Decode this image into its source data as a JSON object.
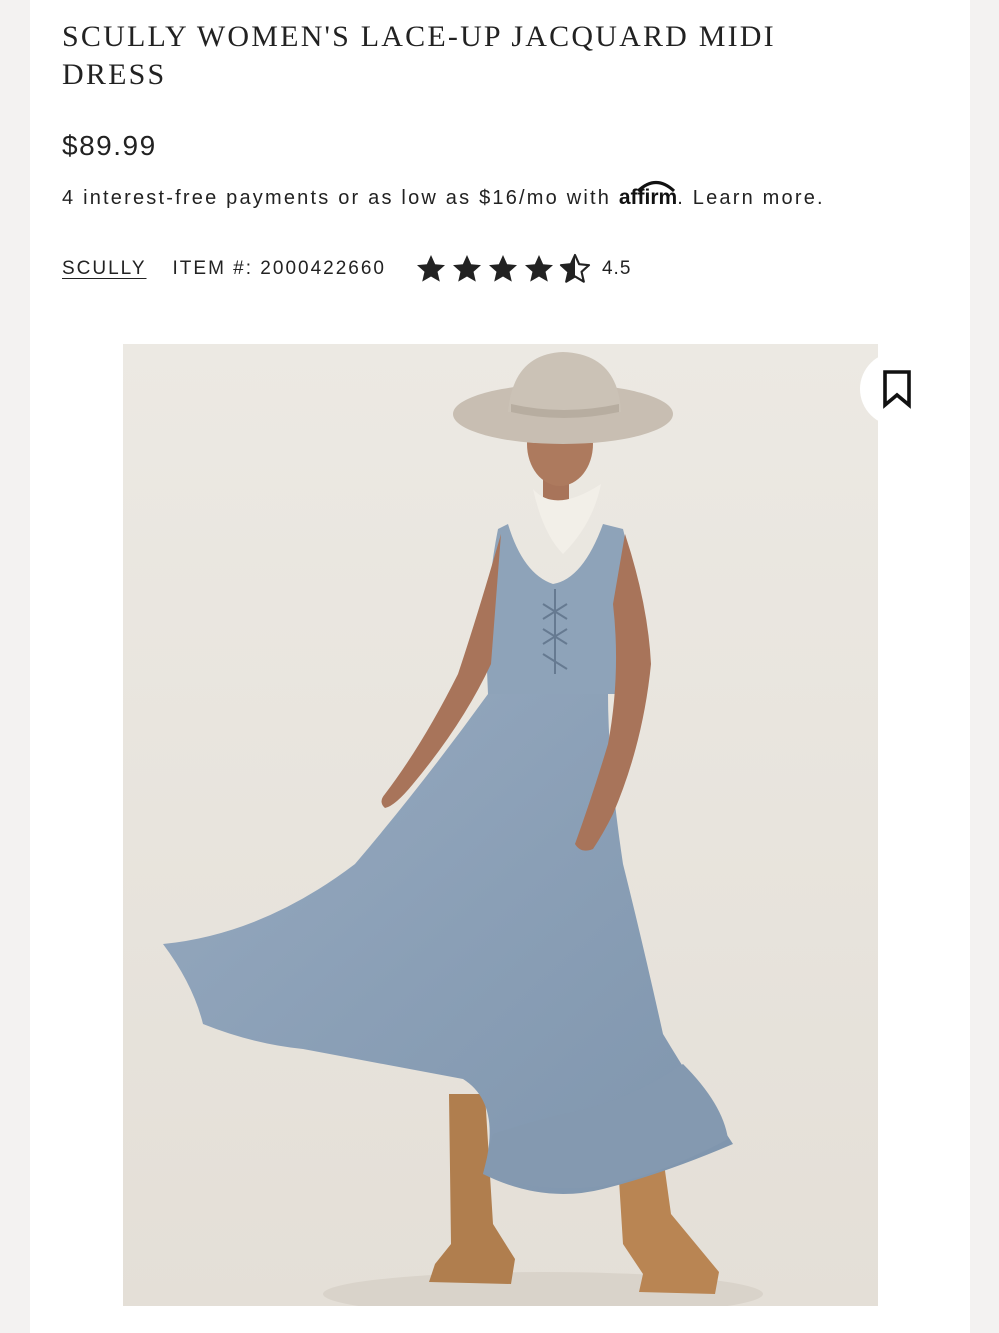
{
  "product": {
    "title": "SCULLY WOMEN'S LACE-UP JACQUARD MIDI DRESS",
    "price": "$89.99",
    "brand": "SCULLY",
    "item_number": "ITEM #: 2000422660",
    "rating": 4.5,
    "rating_label": "4.5"
  },
  "financing": {
    "text": "4 interest-free payments or as low as $16/mo with",
    "provider": "affirm",
    "learn_more": ". Learn more."
  },
  "image": {
    "alt": "Model wearing blue lace-up jacquard midi dress with cowboy hat and tan boots"
  },
  "icons": {
    "bookmark": "bookmark-icon",
    "star": "star-icon",
    "affirm_logo": "affirm-logo"
  },
  "colors": {
    "text": "#222222",
    "dress_blue": "#8fa3b8",
    "background": "#e9e5df"
  }
}
